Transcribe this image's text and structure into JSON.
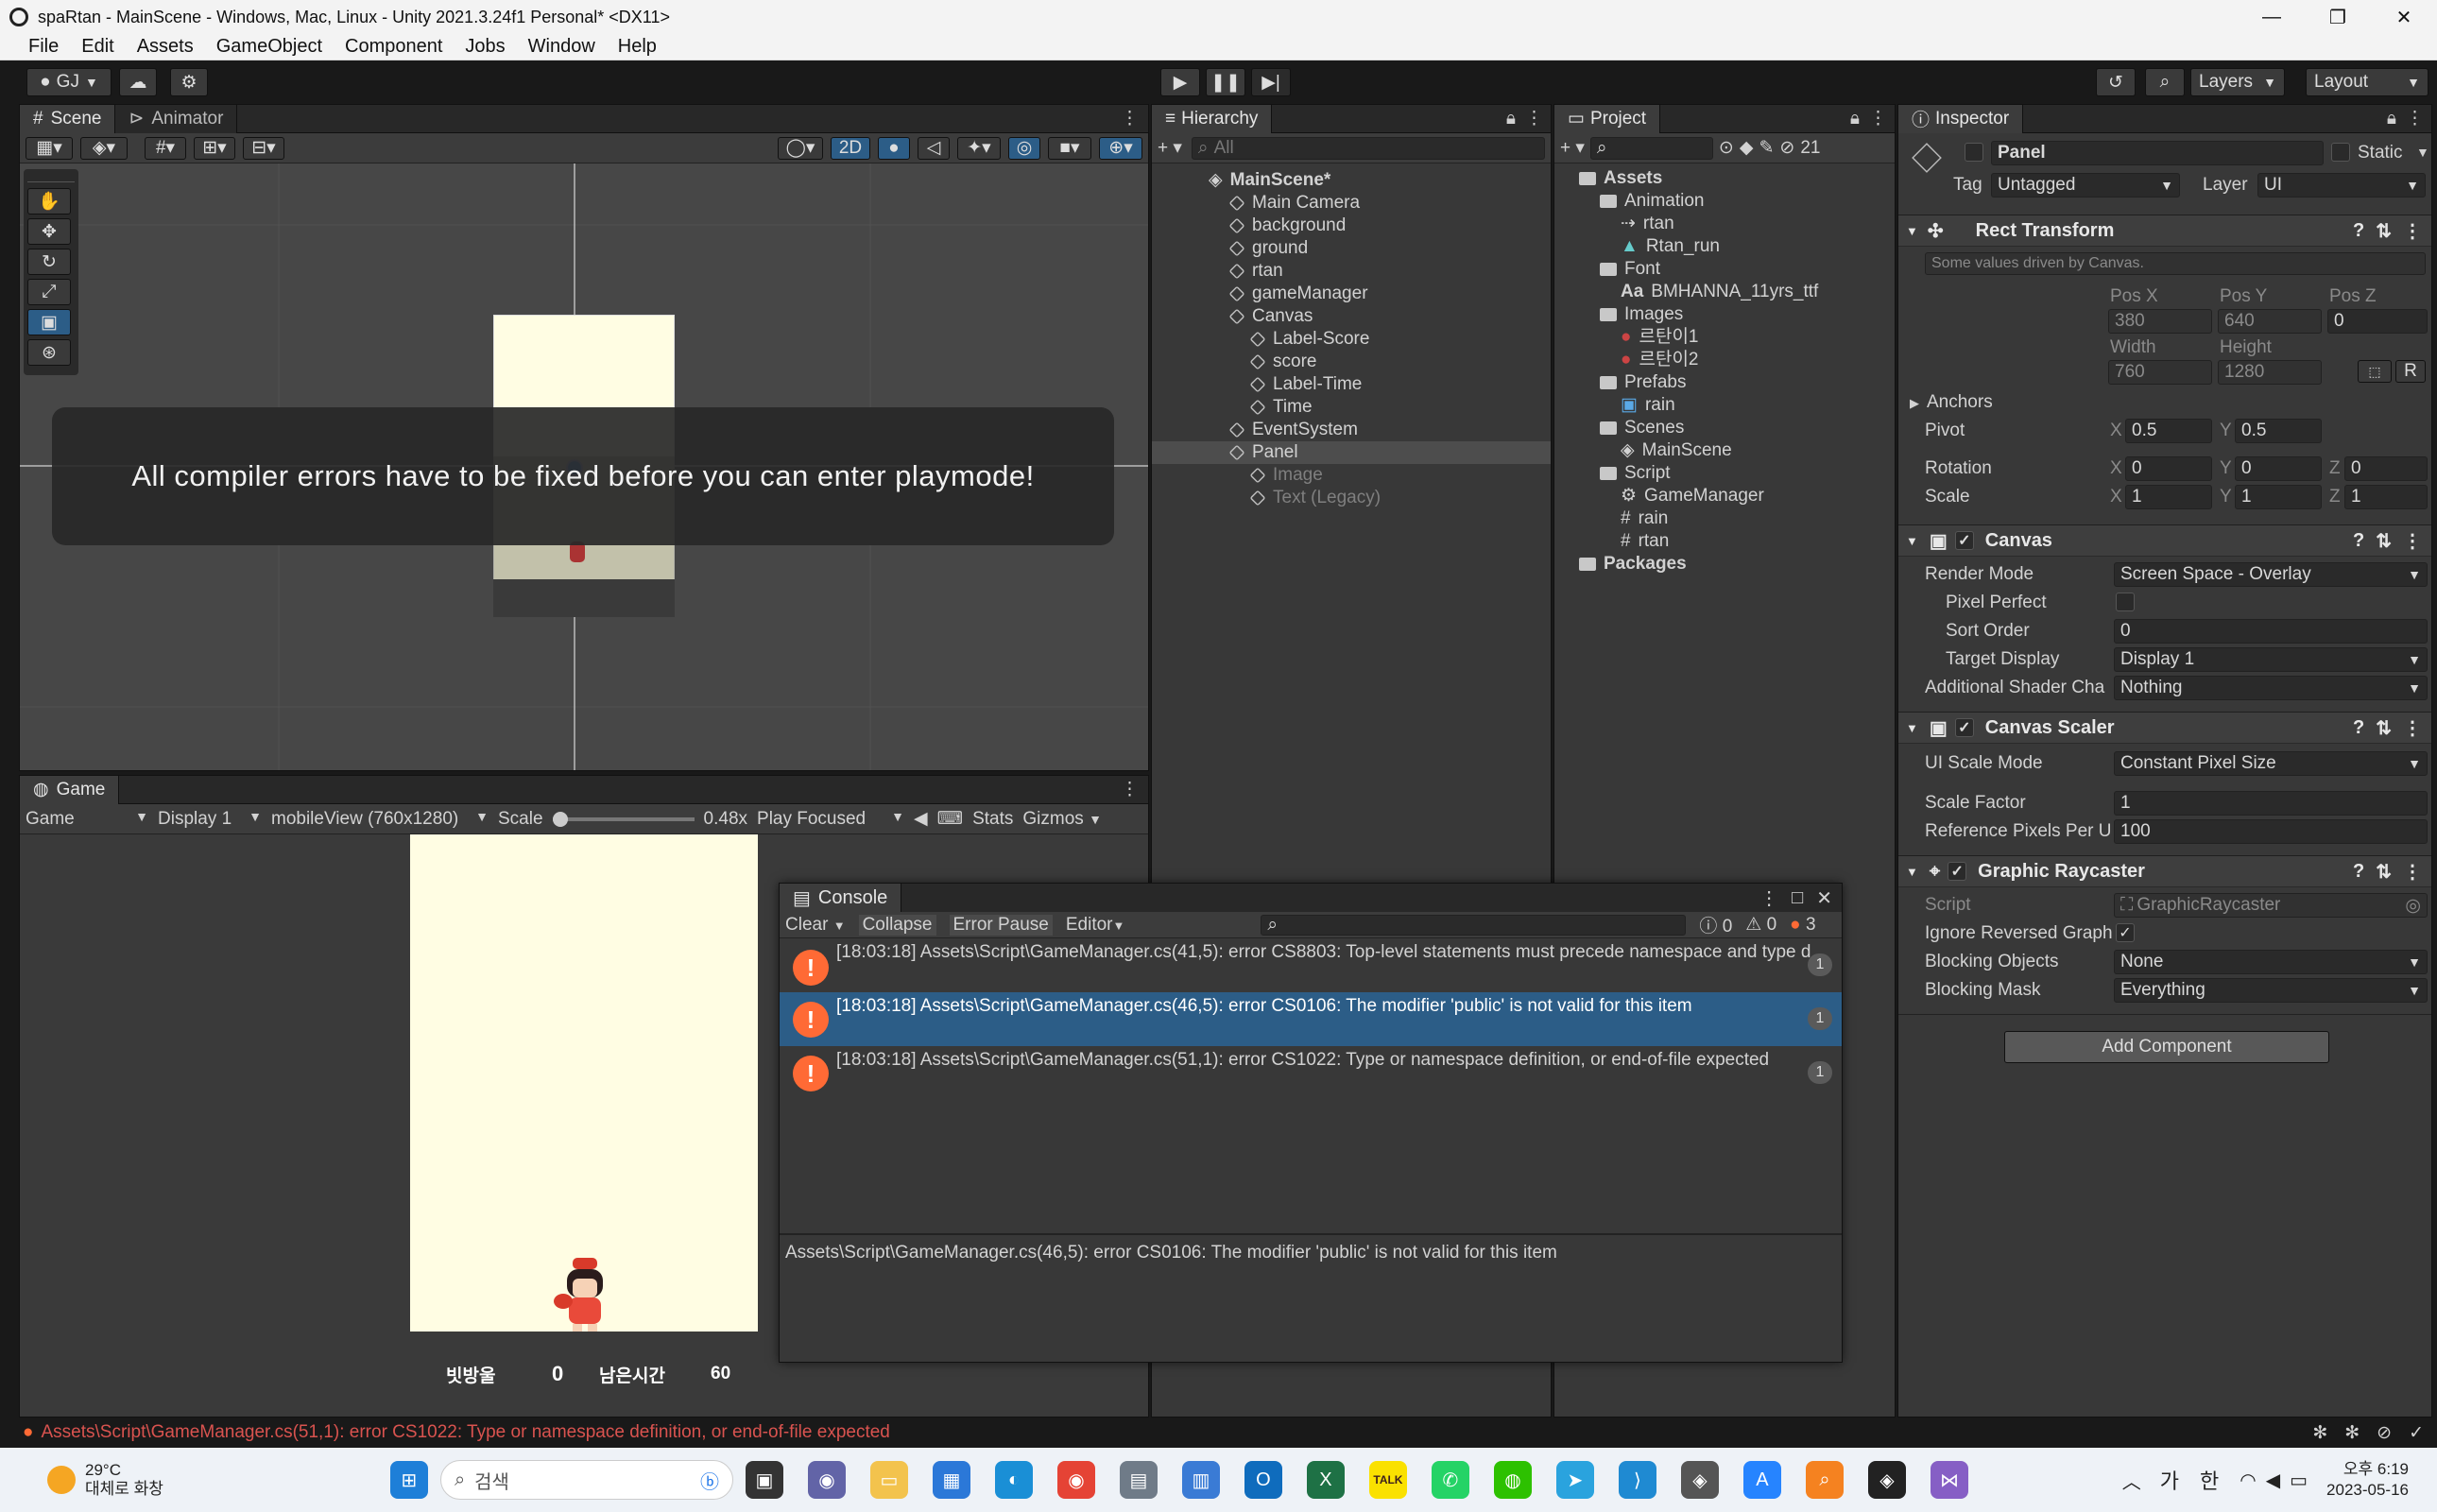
{
  "window": {
    "title": "spaRtan - MainScene - Windows, Mac, Linux - Unity 2021.3.24f1 Personal* <DX11>",
    "minimize": "—",
    "maximize": "❐",
    "close": "✕"
  },
  "menu": [
    "File",
    "Edit",
    "Assets",
    "GameObject",
    "Component",
    "Jobs",
    "Window",
    "Help"
  ],
  "toolbar": {
    "account": "GJ",
    "layers": "Layers",
    "layout": "Layout"
  },
  "scene": {
    "tabs": {
      "scene": "Scene",
      "animator": "Animator"
    },
    "mode_2d": "2D",
    "overlay_message": "All compiler errors have to be fixed before you can enter playmode!"
  },
  "game": {
    "tab": "Game",
    "view": "Game",
    "display": "Display 1",
    "resolution": "mobileView (760x1280)",
    "scale_label": "Scale",
    "scale_value": "0.48x",
    "play_focused": "Play Focused",
    "stats": "Stats",
    "gizmos": "Gizmos",
    "hud": {
      "score_label": "빗방울",
      "score_value": "0",
      "time_label": "남은시간",
      "time_value": "60"
    },
    "background_color": "#fffde3"
  },
  "hierarchy": {
    "tab": "Hierarchy",
    "search_placeholder": "All",
    "items": [
      {
        "label": "MainScene*",
        "depth": 0,
        "kind": "scene",
        "state": "normal"
      },
      {
        "label": "Main Camera",
        "depth": 1,
        "kind": "object",
        "state": "normal"
      },
      {
        "label": "background",
        "depth": 1,
        "kind": "object",
        "state": "normal"
      },
      {
        "label": "ground",
        "depth": 1,
        "kind": "object",
        "state": "normal"
      },
      {
        "label": "rtan",
        "depth": 1,
        "kind": "object",
        "state": "normal"
      },
      {
        "label": "gameManager",
        "depth": 1,
        "kind": "object",
        "state": "normal"
      },
      {
        "label": "Canvas",
        "depth": 1,
        "kind": "object",
        "state": "expanded"
      },
      {
        "label": "Label-Score",
        "depth": 2,
        "kind": "object",
        "state": "normal"
      },
      {
        "label": "score",
        "depth": 2,
        "kind": "object",
        "state": "normal"
      },
      {
        "label": "Label-Time",
        "depth": 2,
        "kind": "object",
        "state": "normal"
      },
      {
        "label": "Time",
        "depth": 2,
        "kind": "object",
        "state": "normal"
      },
      {
        "label": "EventSystem",
        "depth": 1,
        "kind": "object",
        "state": "normal"
      },
      {
        "label": "Panel",
        "depth": 1,
        "kind": "object",
        "state": "selected"
      },
      {
        "label": "Image",
        "depth": 2,
        "kind": "object",
        "state": "disabled"
      },
      {
        "label": "Text (Legacy)",
        "depth": 2,
        "kind": "object",
        "state": "disabled"
      }
    ]
  },
  "project": {
    "tab": "Project",
    "hidden_count": "21",
    "items": [
      {
        "label": "Assets",
        "depth": 0,
        "kind": "folder",
        "bold": true
      },
      {
        "label": "Animation",
        "depth": 1,
        "kind": "folder"
      },
      {
        "label": "rtan",
        "depth": 2,
        "kind": "anim"
      },
      {
        "label": "Rtan_run",
        "depth": 2,
        "kind": "clip"
      },
      {
        "label": "Font",
        "depth": 1,
        "kind": "folder"
      },
      {
        "label": "BMHANNA_11yrs_ttf",
        "depth": 2,
        "kind": "font"
      },
      {
        "label": "Images",
        "depth": 1,
        "kind": "folder"
      },
      {
        "label": "르탄이1",
        "depth": 2,
        "kind": "sprite"
      },
      {
        "label": "르탄이2",
        "depth": 2,
        "kind": "sprite"
      },
      {
        "label": "Prefabs",
        "depth": 1,
        "kind": "folder"
      },
      {
        "label": "rain",
        "depth": 2,
        "kind": "prefab"
      },
      {
        "label": "Scenes",
        "depth": 1,
        "kind": "folder"
      },
      {
        "label": "MainScene",
        "depth": 2,
        "kind": "scene"
      },
      {
        "label": "Script",
        "depth": 1,
        "kind": "folder"
      },
      {
        "label": "GameManager",
        "depth": 2,
        "kind": "script-gear"
      },
      {
        "label": "rain",
        "depth": 2,
        "kind": "script"
      },
      {
        "label": "rtan",
        "depth": 2,
        "kind": "script"
      },
      {
        "label": "Packages",
        "depth": 0,
        "kind": "folder",
        "bold": true
      }
    ]
  },
  "inspector": {
    "tab": "Inspector",
    "object_name": "Panel",
    "static_label": "Static",
    "tag_label": "Tag",
    "tag_value": "Untagged",
    "layer_label": "Layer",
    "layer_value": "UI",
    "rect_transform": {
      "title": "Rect Transform",
      "note": "Some values driven by Canvas.",
      "pos_x_label": "Pos X",
      "pos_y_label": "Pos Y",
      "pos_z_label": "Pos Z",
      "pos_x": "380",
      "pos_y": "640",
      "pos_z": "0",
      "width_label": "Width",
      "height_label": "Height",
      "width": "760",
      "height": "1280",
      "anchors": "Anchors",
      "pivot_label": "Pivot",
      "pivot_x": "0.5",
      "pivot_y": "0.5",
      "rotation_label": "Rotation",
      "rot_x": "0",
      "rot_y": "0",
      "rot_z": "0",
      "scale_label": "Scale",
      "scale_x": "1",
      "scale_y": "1",
      "scale_z": "1",
      "x": "X",
      "y": "Y",
      "z": "Z",
      "r": "R"
    },
    "canvas": {
      "title": "Canvas",
      "render_mode_label": "Render Mode",
      "render_mode": "Screen Space - Overlay",
      "pixel_perfect_label": "Pixel Perfect",
      "sort_order_label": "Sort Order",
      "sort_order": "0",
      "target_display_label": "Target Display",
      "target_display": "Display 1",
      "shader_label": "Additional Shader Cha",
      "shader_value": "Nothing"
    },
    "canvas_scaler": {
      "title": "Canvas Scaler",
      "mode_label": "UI Scale Mode",
      "mode": "Constant Pixel Size",
      "scale_factor_label": "Scale Factor",
      "scale_factor": "1",
      "ref_label": "Reference Pixels Per U",
      "ref_value": "100"
    },
    "graphic_raycaster": {
      "title": "Graphic Raycaster",
      "script_label": "Script",
      "script_value": "GraphicRaycaster",
      "ignore_label": "Ignore Reversed Graph",
      "blocking_label": "Blocking Objects",
      "blocking_value": "None",
      "mask_label": "Blocking Mask",
      "mask_value": "Everything"
    },
    "add_component": "Add Component"
  },
  "console": {
    "tab": "Console",
    "clear": "Clear",
    "collapse": "Collapse",
    "error_pause": "Error Pause",
    "editor": "Editor",
    "count_log": "0",
    "count_warn": "0",
    "count_error": "3",
    "messages": [
      {
        "text": "[18:03:18] Assets\\Script\\GameManager.cs(41,5): error CS8803: Top-level statements must precede namespace and type d",
        "count": "1",
        "selected": false
      },
      {
        "text": "[18:03:18] Assets\\Script\\GameManager.cs(46,5): error CS0106: The modifier 'public' is not valid for this item",
        "count": "1",
        "selected": true
      },
      {
        "text": "[18:03:18] Assets\\Script\\GameManager.cs(51,1): error CS1022: Type or namespace definition, or end-of-file expected",
        "count": "1",
        "selected": false
      }
    ],
    "detail": "Assets\\Script\\GameManager.cs(46,5): error CS0106: The modifier 'public' is not valid for this item"
  },
  "statusbar": {
    "message": "Assets\\Script\\GameManager.cs(51,1): error CS1022: Type or namespace definition, or end-of-file expected"
  },
  "taskbar": {
    "weather_temp": "29°C",
    "weather_desc": "대체로 화창",
    "search_placeholder": "검색",
    "ime_1": "가",
    "ime_2": "한",
    "time": "오후 6:19",
    "date": "2023-05-16",
    "talk": "TALK"
  },
  "colors": {
    "accent": "#2c5d87",
    "error": "#ff6a35",
    "status_error": "#d9534f",
    "scene_bg": "#474747"
  }
}
